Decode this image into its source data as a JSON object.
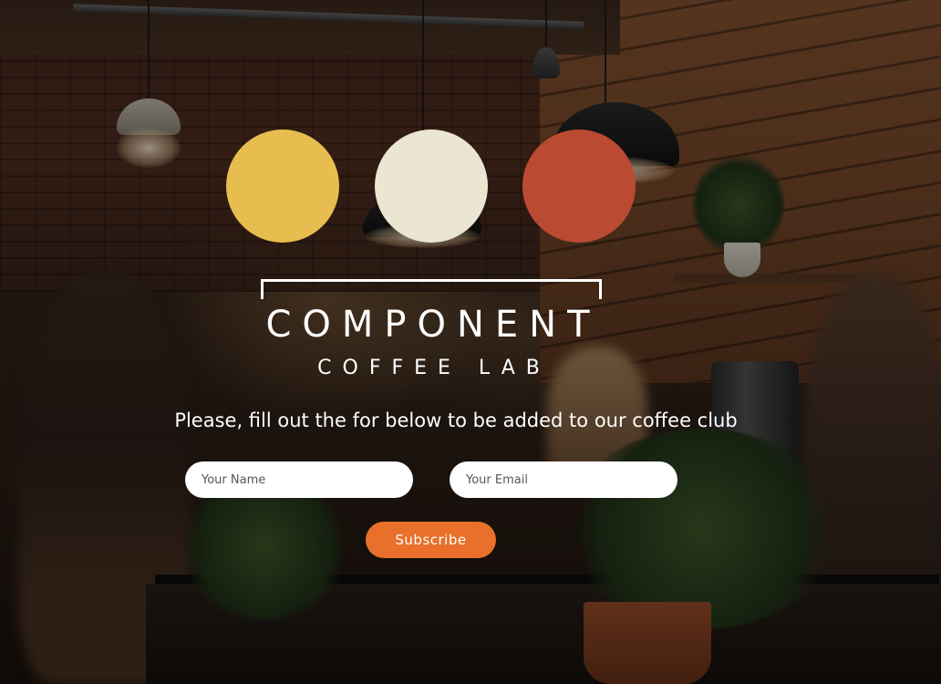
{
  "palette": {
    "swatches": [
      {
        "color": "#e8bd4f"
      },
      {
        "color": "#ebe6d2"
      },
      {
        "color": "#bb4a33"
      }
    ]
  },
  "logo": {
    "main_text": "COMPONENT",
    "sub_text": "COFFEE LAB"
  },
  "headline": "Please, fill out the for below to be added to our coffee club",
  "form": {
    "name_placeholder": "Your Name",
    "email_placeholder": "Your Email",
    "subscribe_label": "Subscribe",
    "accent_color": "#e8702a"
  }
}
